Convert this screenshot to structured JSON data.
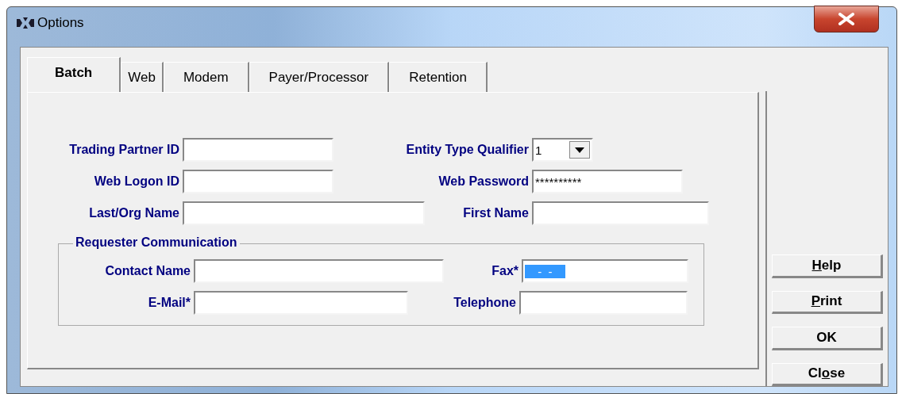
{
  "window": {
    "title": "Options"
  },
  "tabs": [
    {
      "label": "Batch",
      "selected": true
    },
    {
      "label": "Web",
      "selected": false
    },
    {
      "label": "Modem",
      "selected": false
    },
    {
      "label": "Payer/Processor",
      "selected": false
    },
    {
      "label": "Retention",
      "selected": false
    }
  ],
  "rows": [
    [
      {
        "label": "Trading Partner ID",
        "kind": "text"
      },
      {
        "label": "Entity Type Qualifier",
        "kind": "combo",
        "value": "1"
      }
    ],
    [
      {
        "label": "Web Logon ID",
        "kind": "text"
      },
      {
        "label": "Web Password",
        "kind": "text",
        "value": "**********"
      }
    ],
    [
      {
        "label": "Last/Org Name",
        "kind": "text"
      },
      {
        "label": "First Name",
        "kind": "text"
      }
    ]
  ],
  "group": {
    "title": "Requester Communication",
    "rows": [
      [
        {
          "label": "Contact Name",
          "kind": "text"
        },
        {
          "label": "Fax*",
          "kind": "text",
          "value": " -  - ",
          "selected": true
        }
      ],
      [
        {
          "label": "E-Mail*",
          "kind": "text"
        },
        {
          "label": "Telephone",
          "kind": "text"
        }
      ]
    ]
  },
  "buttons": [
    {
      "parts": [
        {
          "text": "H",
          "underlined": true
        },
        {
          "text": "elp",
          "underlined": false
        }
      ]
    },
    {
      "parts": [
        {
          "text": "P",
          "underlined": true
        },
        {
          "text": "rint",
          "underlined": false
        }
      ]
    },
    {
      "parts": [
        {
          "text": "OK",
          "underlined": false
        }
      ]
    },
    {
      "parts": [
        {
          "text": "Cl",
          "underlined": false
        },
        {
          "text": "o",
          "underlined": true
        },
        {
          "text": "se",
          "underlined": false
        }
      ]
    }
  ]
}
